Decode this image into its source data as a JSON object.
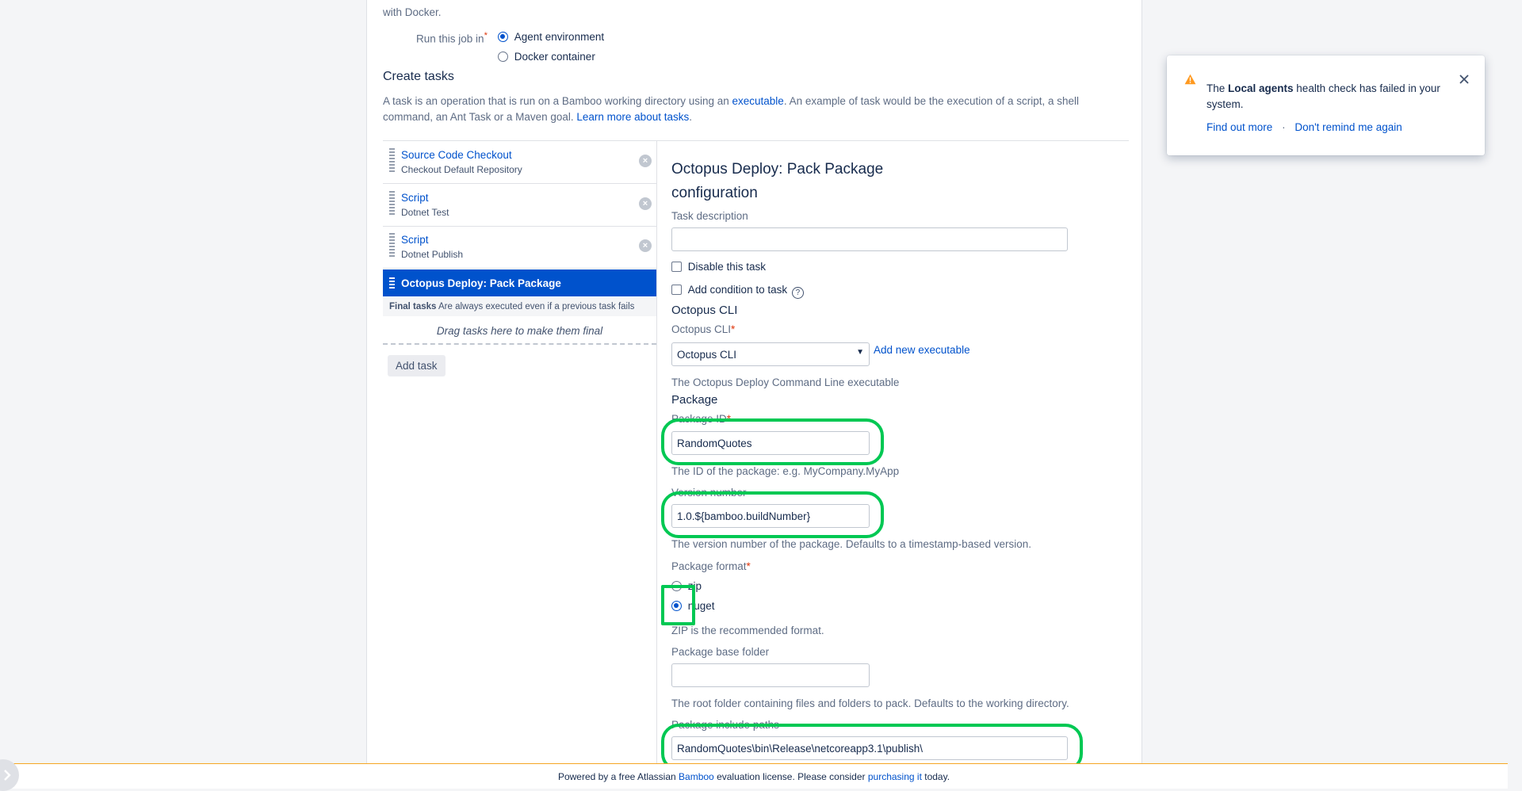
{
  "top": {
    "docker_note": "with Docker.",
    "run_job_label": "Run this job in",
    "run_job_options": [
      "Agent environment",
      "Docker container"
    ]
  },
  "create_tasks": {
    "heading": "Create tasks",
    "desc_part1": "A task is an operation that is run on a Bamboo working directory using an ",
    "desc_link1": "executable",
    "desc_part2": ". An example of task would be the execution of a script, a shell command, an Ant Task or a Maven goal. ",
    "desc_link2": "Learn more about tasks",
    "desc_part3": "."
  },
  "tasks": [
    {
      "title": "Source Code Checkout",
      "subtitle": "Checkout Default Repository"
    },
    {
      "title": "Script",
      "subtitle": "Dotnet Test"
    },
    {
      "title": "Script",
      "subtitle": "Dotnet Publish"
    },
    {
      "title": "Octopus Deploy: Pack Package",
      "subtitle": ""
    }
  ],
  "final_tasks": {
    "label": "Final tasks",
    "desc": "Are always executed even if a previous task fails",
    "drop_hint": "Drag tasks here to make them final"
  },
  "add_task_button": "Add task",
  "config": {
    "title_line1": "Octopus Deploy: Pack Package",
    "title_line2": "configuration",
    "task_description_label": "Task description",
    "task_description_value": "",
    "disable_task_label": "Disable this task",
    "add_condition_label": "Add condition to task",
    "octopus_cli_heading": "Octopus CLI",
    "octopus_cli_label": "Octopus CLI",
    "octopus_cli_selected": "Octopus CLI",
    "add_executable_link": "Add new executable",
    "octopus_cli_help": "The Octopus Deploy Command Line executable",
    "package_heading": "Package",
    "package_id_label": "Package ID",
    "package_id_value": "RandomQuotes",
    "package_id_help": "The ID of the package: e.g. MyCompany.MyApp",
    "version_label": "Version number",
    "version_value": "1.0.${bamboo.buildNumber}",
    "version_help": "The version number of the package. Defaults to a timestamp-based version.",
    "format_label": "Package format",
    "format_options": [
      "zip",
      "nuget"
    ],
    "format_selected": "nuget",
    "format_help": "ZIP is the recommended format.",
    "base_folder_label": "Package base folder",
    "base_folder_value": "",
    "base_folder_help": "The root folder containing files and folders to pack. Defaults to the working directory.",
    "include_paths_label": "Package include paths",
    "include_paths_value": "RandomQuotes\\bin\\Release\\netcoreapp3.1\\publish\\"
  },
  "toast": {
    "text_pre": "The ",
    "text_bold": "Local agents",
    "text_post": " health check has failed in your system.",
    "link_find": "Find out more",
    "separator": "·",
    "link_dont": "Don't remind me again"
  },
  "footer": {
    "part1": "Powered by a free Atlassian ",
    "link_bamboo": "Bamboo",
    "part2": " evaluation license. Please consider ",
    "link_purchasing": "purchasing it",
    "part3": " today."
  },
  "colors": {
    "accent": "#0052cc",
    "highlight": "#00c853",
    "required": "#de350b",
    "warning": "#ff991f"
  },
  "icons": [
    "warning-icon",
    "close-icon",
    "help-icon",
    "chevron-down-icon",
    "remove-task-icon",
    "drag-handle-icon",
    "expand-arrow-icon"
  ]
}
